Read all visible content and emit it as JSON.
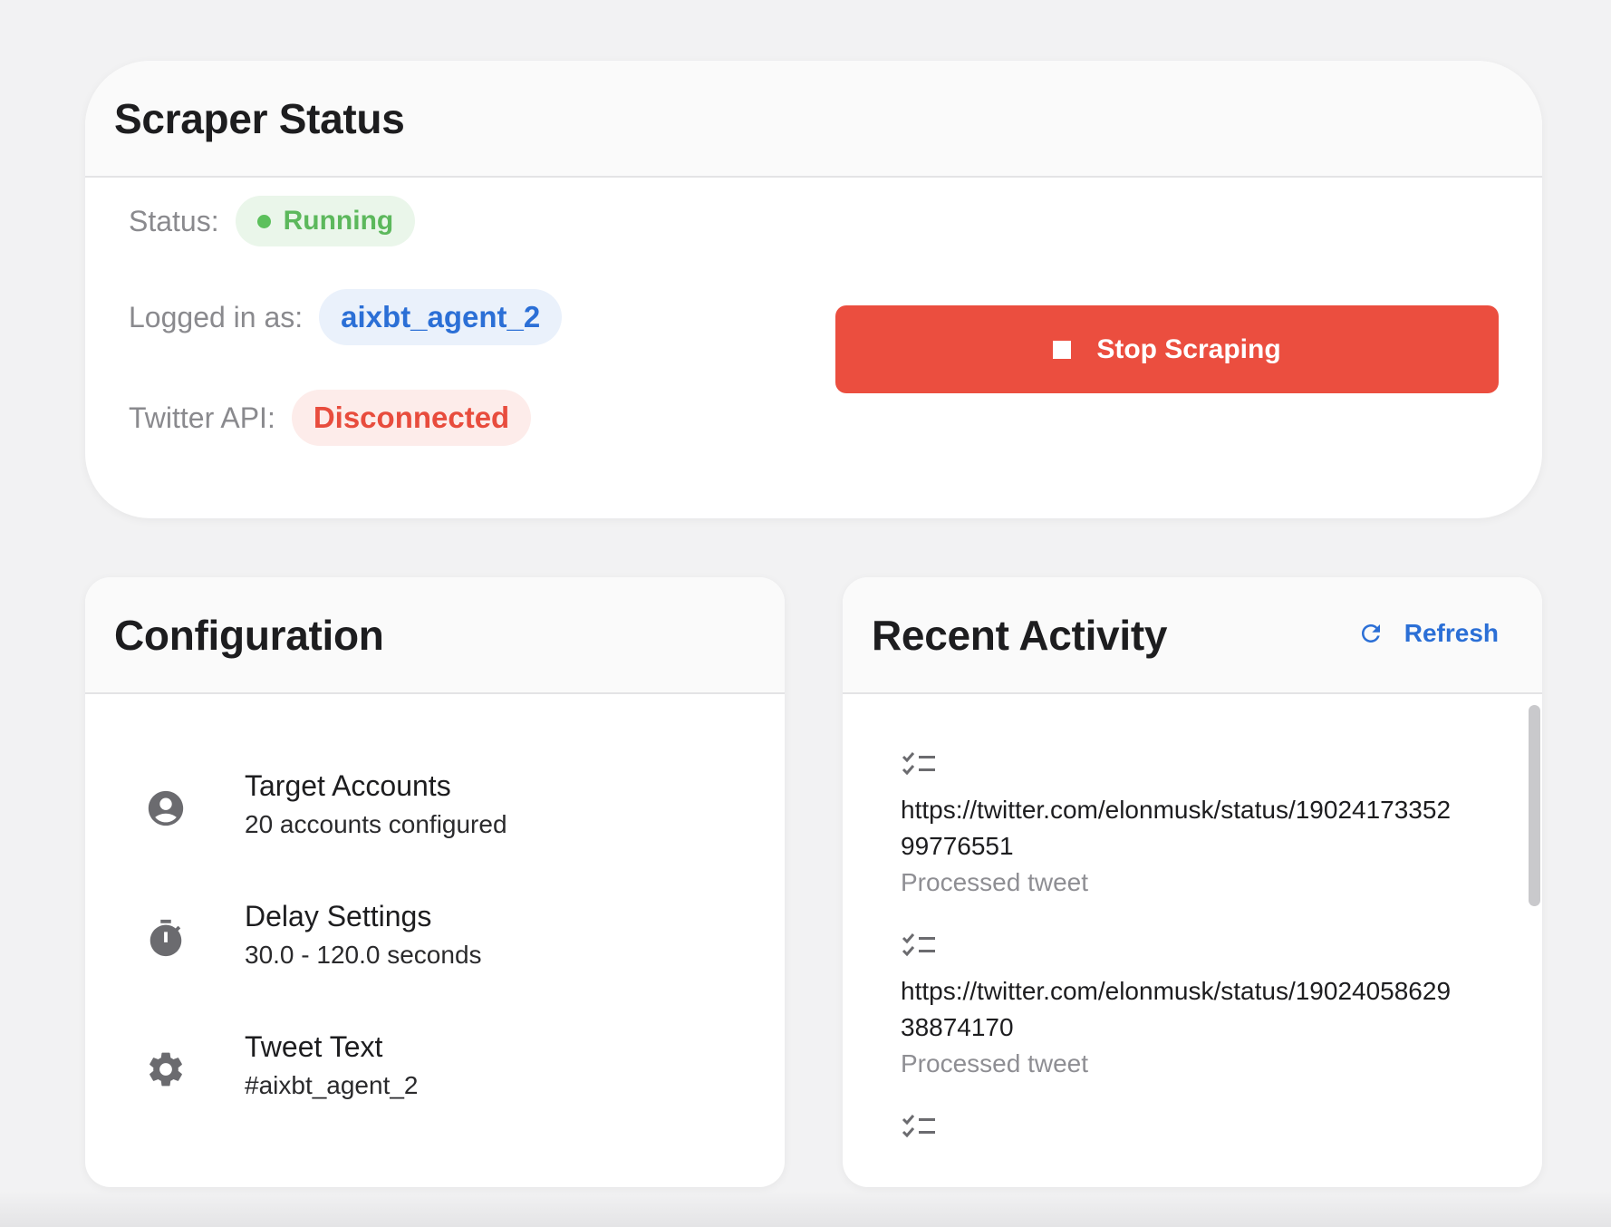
{
  "status_card": {
    "title": "Scraper Status",
    "status_label": "Status:",
    "status_value": "Running",
    "logged_label": "Logged in as:",
    "logged_value": "aixbt_agent_2",
    "api_label": "Twitter API:",
    "api_value": "Disconnected",
    "stop_button": "Stop Scraping"
  },
  "config_card": {
    "title": "Configuration",
    "items": [
      {
        "icon": "account-circle-icon",
        "title": "Target Accounts",
        "subtitle": "20 accounts configured"
      },
      {
        "icon": "timer-icon",
        "title": "Delay Settings",
        "subtitle": "30.0 - 120.0 seconds"
      },
      {
        "icon": "gear-icon",
        "title": "Tweet Text",
        "subtitle": "#aixbt_agent_2"
      }
    ]
  },
  "activity_card": {
    "title": "Recent Activity",
    "refresh_label": "Refresh",
    "items": [
      {
        "icon": "checklist-icon",
        "url": "https://twitter.com/elonmusk/status/1902417335299776551",
        "note": "Processed tweet"
      },
      {
        "icon": "checklist-icon",
        "url": "https://twitter.com/elonmusk/status/1902405862938874170",
        "note": "Processed tweet"
      },
      {
        "icon": "checklist-icon",
        "url": "",
        "note": ""
      }
    ]
  },
  "colors": {
    "running_green": "#5cb85c",
    "user_blue": "#2b6fd6",
    "disconnected_red": "#e84c3d",
    "stop_button_red": "#eb4e3f"
  }
}
